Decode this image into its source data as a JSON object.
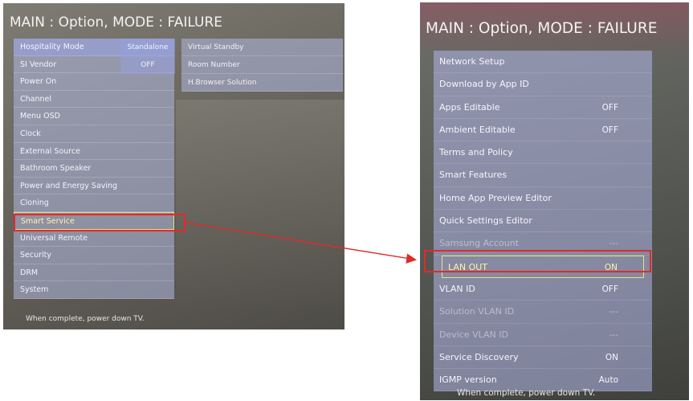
{
  "left_screen": {
    "title": "MAIN : Option, MODE : FAILURE",
    "menu": [
      "Hospitality Mode",
      "SI Vendor",
      "Power On",
      "Channel",
      "Menu OSD",
      "Clock",
      "External Source",
      "Bathroom Speaker",
      "Power and Energy Saving",
      "Cloning",
      "Smart Service",
      "Universal Remote",
      "Security",
      "DRM",
      "System"
    ],
    "values": [
      "Standalone",
      "OFF"
    ],
    "submenu": [
      "Virtual Standby",
      "Room Number",
      "H.Browser Solution"
    ],
    "footer": "When complete, power down TV."
  },
  "right_screen": {
    "title": "MAIN : Option, MODE : FAILURE",
    "menu": [
      {
        "label": "Network Setup",
        "value": ""
      },
      {
        "label": "Download by App ID",
        "value": ""
      },
      {
        "label": "Apps Editable",
        "value": "OFF"
      },
      {
        "label": "Ambient Editable",
        "value": "OFF"
      },
      {
        "label": "Terms and Policy",
        "value": ""
      },
      {
        "label": "Smart Features",
        "value": ""
      },
      {
        "label": "Home App Preview Editor",
        "value": ""
      },
      {
        "label": "Quick Settings Editor",
        "value": ""
      },
      {
        "label": "Samsung Account",
        "value": "---"
      },
      {
        "label": "LAN OUT",
        "value": "ON"
      },
      {
        "label": "VLAN ID",
        "value": "OFF"
      },
      {
        "label": "Solution VLAN ID",
        "value": "---"
      },
      {
        "label": "Device VLAN ID",
        "value": "---"
      },
      {
        "label": "Service Discovery",
        "value": "ON"
      },
      {
        "label": "IGMP version",
        "value": "Auto"
      }
    ],
    "footer": "When complete, power down TV."
  },
  "colors": {
    "highlight": "#e12a2a",
    "selection": "#ece17e"
  }
}
